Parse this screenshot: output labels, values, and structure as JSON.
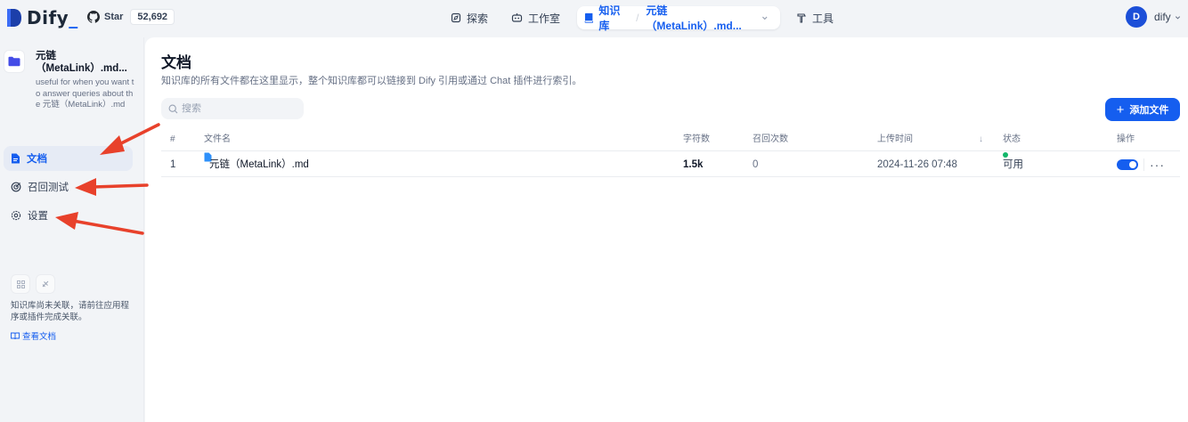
{
  "header": {
    "logo_text": "Dify",
    "github_label": "Star",
    "github_count": "52,692",
    "nav": {
      "explore": "探索",
      "studio": "工作室",
      "knowledge": "知识库",
      "current_dataset": "元链（MetaLink）.md...",
      "tools": "工具"
    },
    "user": {
      "avatar_letter": "D",
      "name": "dify"
    }
  },
  "sidebar": {
    "dataset_name": "元链（MetaLink）.md...",
    "dataset_description": "useful for when you want to answer queries about the 元链（MetaLink）.md",
    "menu": {
      "documents": "文档",
      "hit_testing": "召回测试",
      "settings": "设置"
    },
    "unlinked_notice": "知识库尚未关联，请前往应用程序或插件完成关联。",
    "view_docs": "查看文档"
  },
  "main": {
    "title": "文档",
    "description": "知识库的所有文件都在这里显示，整个知识库都可以链接到 Dify 引用或通过 Chat 插件进行索引。",
    "search_placeholder": "搜索",
    "add_button": "添加文件",
    "table": {
      "headers": {
        "index": "#",
        "name": "文件名",
        "chars": "字符数",
        "hits": "召回次数",
        "upload_time": "上传时间",
        "status": "状态",
        "actions": "操作"
      },
      "rows": [
        {
          "index": "1",
          "name": "元链（MetaLink）.md",
          "chars": "1.5k",
          "hits": "0",
          "upload_time": "2024-11-26 07:48",
          "status": "可用",
          "enabled": true
        }
      ]
    }
  },
  "colors": {
    "accent": "#155eef",
    "status_available": "#12b76a",
    "annotation_arrow": "#e8412b"
  }
}
